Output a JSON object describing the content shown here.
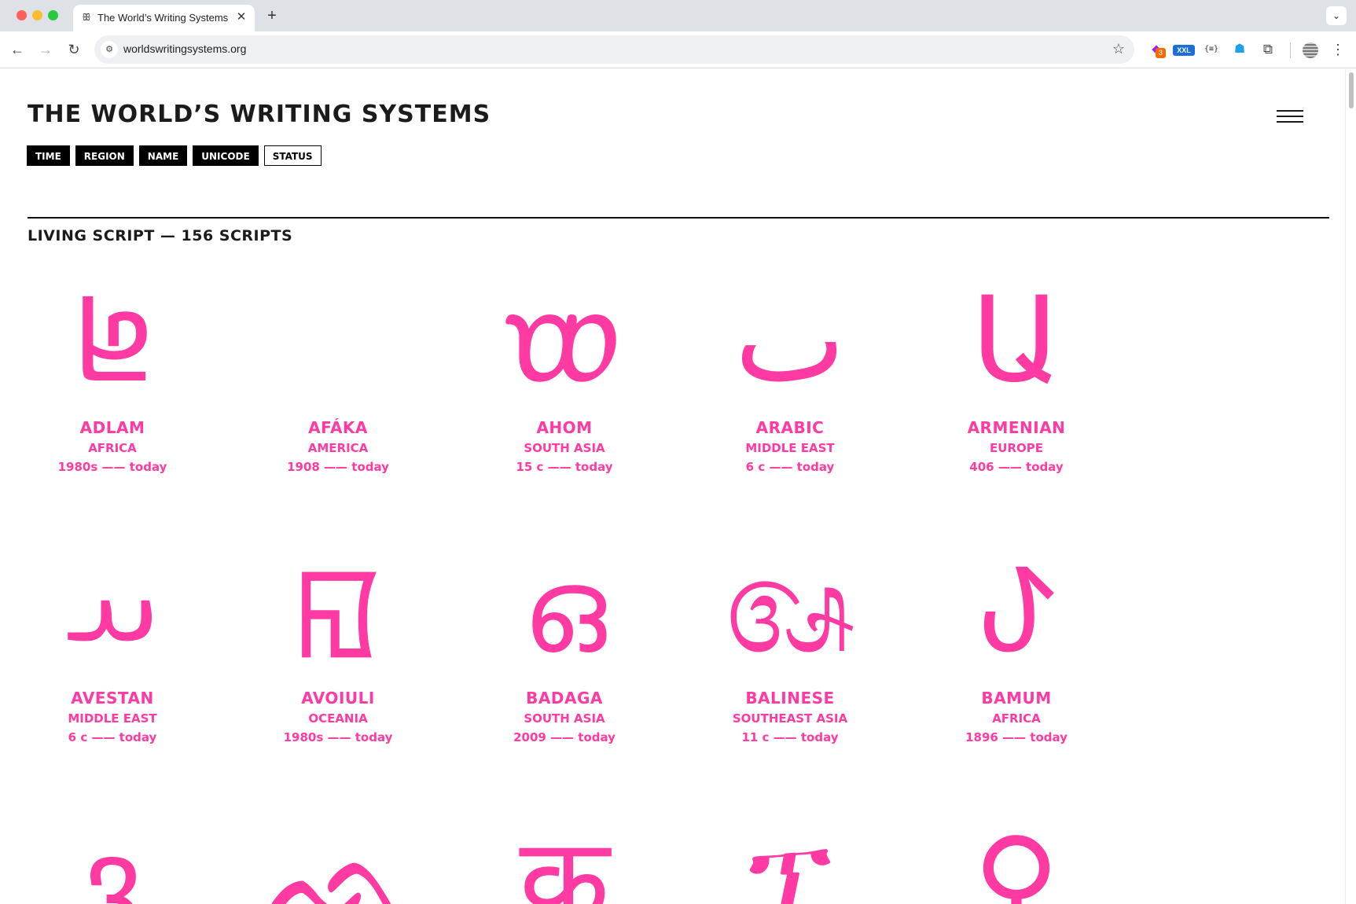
{
  "browser": {
    "tab_title": "The World’s Writing Systems",
    "tab_favicon": "ꕥ",
    "tab_close": "✕",
    "new_tab": "+",
    "tab_search": "⌄",
    "url": "worldswritingsystems.org",
    "site_info_icon": "⚙",
    "star_icon": "☆",
    "back_icon": "←",
    "forward_icon": "→",
    "reload_icon": "↻",
    "extensions": {
      "ext1_badge": "3",
      "ext2_label": "XXL",
      "ext3_label": "{≡}",
      "ext4_icon": "☗",
      "ext5_icon": "⧉"
    },
    "menu_icon": "⋮"
  },
  "page": {
    "title": "THE WORLD’S WRITING SYSTEMS",
    "filters": [
      {
        "label": "TIME",
        "active": true
      },
      {
        "label": "REGION",
        "active": true
      },
      {
        "label": "NAME",
        "active": true
      },
      {
        "label": "UNICODE",
        "active": true
      },
      {
        "label": "STATUS",
        "active": false
      }
    ],
    "section_heading": "LIVING SCRIPT — 156 SCRIPTS",
    "accent_color": "#ff3aa2",
    "scripts": [
      {
        "glyph": "𞤦",
        "name": "ADLAM",
        "region": "AFRICA",
        "dates": "1980s —— today"
      },
      {
        "glyph": "𞗅",
        "name": "AFÁKA",
        "region": "AMERICA",
        "dates": "1908 —— today"
      },
      {
        "glyph": "𑜌",
        "name": "AHOM",
        "region": "SOUTH ASIA",
        "dates": "15 c —— today"
      },
      {
        "glyph": "ٮ",
        "name": "ARABIC",
        "region": "MIDDLE EAST",
        "dates": "6 c —— today"
      },
      {
        "glyph": "Ա",
        "name": "ARMENIAN",
        "region": "EUROPE",
        "dates": "406 —— today"
      },
      {
        "glyph": "𐬀",
        "name": "AVESTAN",
        "region": "MIDDLE EAST",
        "dates": "6 c —— today"
      },
      {
        "glyph": "ꡎ",
        "name": "AVOIULI",
        "region": "OCEANIA",
        "dates": "1980s —— today"
      },
      {
        "glyph": "ഒ",
        "name": "BADAGA",
        "region": "SOUTH ASIA",
        "dates": "2009 —— today"
      },
      {
        "glyph": "ᬅ",
        "name": "BALINESE",
        "region": "SOUTHEAST ASIA",
        "dates": "11 c —— today"
      },
      {
        "glyph": "ꚠ",
        "name": "BAMUM",
        "region": "AFRICA",
        "dates": "1896 —— today"
      },
      {
        "glyph": "ვ",
        "name": "",
        "region": "",
        "dates": ""
      },
      {
        "glyph": "ᨒ",
        "name": "",
        "region": "",
        "dates": ""
      },
      {
        "glyph": "क",
        "name": "",
        "region": "",
        "dates": ""
      },
      {
        "glyph": "ፕ",
        "name": "",
        "region": "",
        "dates": ""
      },
      {
        "glyph": "⚲",
        "name": "",
        "region": "",
        "dates": ""
      }
    ]
  }
}
